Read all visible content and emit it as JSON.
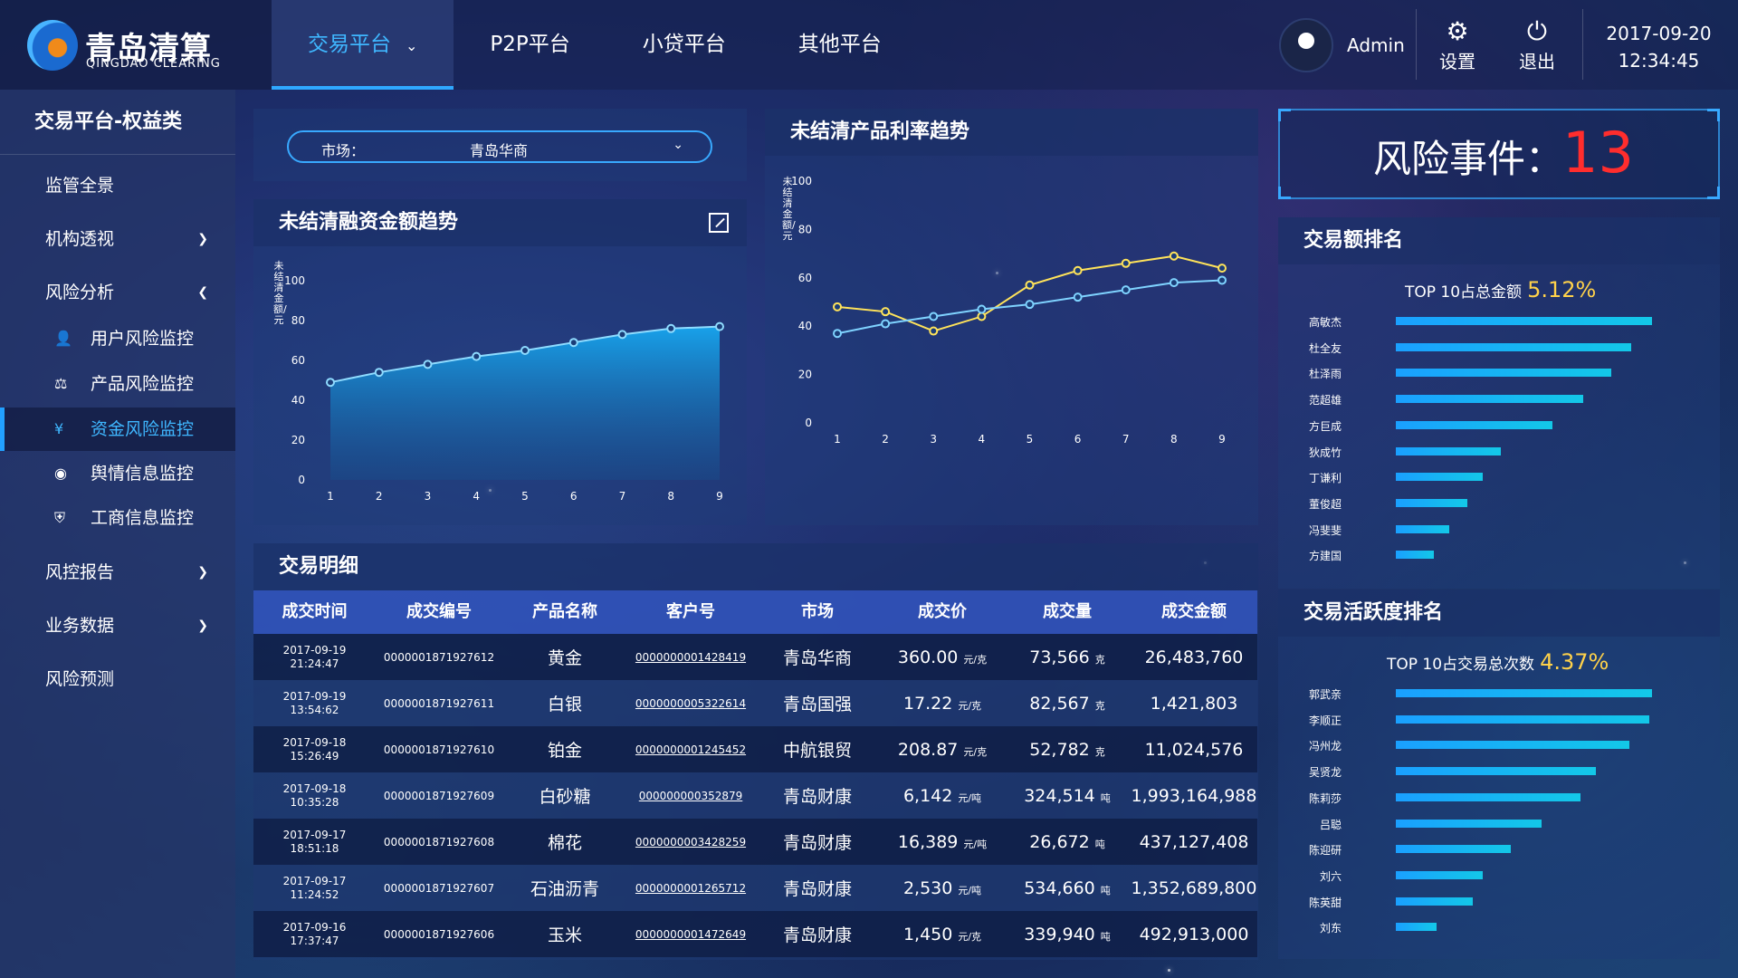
{
  "header": {
    "logo_cn": "青岛清算",
    "logo_en": "QINGDAO CLEARING",
    "nav": [
      {
        "label": "交易平台"
      },
      {
        "label": "P2P平台"
      },
      {
        "label": "小贷平台"
      },
      {
        "label": "其他平台"
      }
    ],
    "user_name": "Admin",
    "settings_label": "设置",
    "logout_label": "退出",
    "date": "2017-09-20",
    "time": "12:34:45"
  },
  "sidebar": {
    "title": "交易平台-权益类",
    "items": [
      {
        "label": "监管全景"
      },
      {
        "label": "机构透视"
      },
      {
        "label": "风险分析"
      },
      {
        "label": "用户风险监控"
      },
      {
        "label": "产品风险监控"
      },
      {
        "label": "资金风险监控"
      },
      {
        "label": "舆情信息监控"
      },
      {
        "label": "工商信息监控"
      },
      {
        "label": "风控报告"
      },
      {
        "label": "业务数据"
      },
      {
        "label": "风险预测"
      }
    ]
  },
  "market": {
    "label": "市场：",
    "value": "青岛华商"
  },
  "chart_data": [
    {
      "type": "area",
      "title": "未结清融资金额趋势",
      "ylabel": "未结清金额/元",
      "x": [
        1,
        2,
        3,
        4,
        5,
        6,
        7,
        8,
        9
      ],
      "values": [
        49,
        54,
        58,
        62,
        65,
        69,
        73,
        76,
        77
      ],
      "ylim": [
        0,
        100
      ],
      "yticks": [
        0,
        20,
        40,
        60,
        80,
        100
      ]
    },
    {
      "type": "line",
      "title": "未结清产品利率趋势",
      "ylabel": "未结清金额/元",
      "x": [
        1,
        2,
        3,
        4,
        5,
        6,
        7,
        8,
        9
      ],
      "series": [
        {
          "color": "#ffe35a",
          "values": [
            48,
            46,
            38,
            44,
            57,
            63,
            66,
            69,
            64
          ]
        },
        {
          "color": "#7fd3ff",
          "values": [
            37,
            41,
            44,
            47,
            49,
            52,
            55,
            58,
            59
          ]
        }
      ],
      "ylim": [
        0,
        100
      ],
      "yticks": [
        0,
        20,
        40,
        60,
        80,
        100
      ]
    }
  ],
  "risk": {
    "label": "风险事件：",
    "count": "13"
  },
  "trade_rank": {
    "title": "交易额排名",
    "top_text": "TOP 10占总金额",
    "top_pct": "5.12%",
    "names": [
      "高敏杰",
      "杜全友",
      "杜泽雨",
      "范超雄",
      "方巨成",
      "狄成竹",
      "丁谦利",
      "董俊超",
      "冯斐斐",
      "方建国"
    ],
    "values": [
      100,
      92,
      84,
      73,
      61,
      41,
      34,
      28,
      21,
      15
    ]
  },
  "active_rank": {
    "title": "交易活跃度排名",
    "top_text": "TOP 10占交易总次数",
    "top_pct": "4.37%",
    "names": [
      "郭武亲",
      "李顺正",
      "冯州龙",
      "吴贤龙",
      "陈莉莎",
      "吕聪",
      "陈迎研",
      "刘六",
      "陈英甜",
      "刘东"
    ],
    "values": [
      100,
      99,
      91,
      78,
      72,
      57,
      45,
      34,
      30,
      16
    ]
  },
  "table": {
    "title": "交易明细",
    "columns": [
      "成交时间",
      "成交编号",
      "产品名称",
      "客户号",
      "市场",
      "成交价",
      "成交量",
      "成交金额"
    ],
    "rows": [
      {
        "date": "2017-09-19",
        "time": "21:24:47",
        "id": "0000001871927612",
        "product": "黄金",
        "cust": "0000000001428419",
        "market": "青岛华商",
        "price": "360.00",
        "price_unit": "元/克",
        "qty": "73,566",
        "qty_unit": "克",
        "amount": "26,483,760"
      },
      {
        "date": "2017-09-19",
        "time": "13:54:62",
        "id": "0000001871927611",
        "product": "白银",
        "cust": "0000000005322614",
        "market": "青岛国强",
        "price": "17.22",
        "price_unit": "元/克",
        "qty": "82,567",
        "qty_unit": "克",
        "amount": "1,421,803"
      },
      {
        "date": "2017-09-18",
        "time": "15:26:49",
        "id": "0000001871927610",
        "product": "铂金",
        "cust": "0000000001245452",
        "market": "中航银贸",
        "price": "208.87",
        "price_unit": "元/克",
        "qty": "52,782",
        "qty_unit": "克",
        "amount": "11,024,576"
      },
      {
        "date": "2017-09-18",
        "time": "10:35:28",
        "id": "0000001871927609",
        "product": "白砂糖",
        "cust": "000000000352879",
        "market": "青岛财康",
        "price": "6,142",
        "price_unit": "元/吨",
        "qty": "324,514",
        "qty_unit": "吨",
        "amount": "1,993,164,988"
      },
      {
        "date": "2017-09-17",
        "time": "18:51:18",
        "id": "0000001871927608",
        "product": "棉花",
        "cust": "0000000003428259",
        "market": "青岛财康",
        "price": "16,389",
        "price_unit": "元/吨",
        "qty": "26,672",
        "qty_unit": "吨",
        "amount": "437,127,408"
      },
      {
        "date": "2017-09-17",
        "time": "11:24:52",
        "id": "0000001871927607",
        "product": "石油沥青",
        "cust": "0000000001265712",
        "market": "青岛财康",
        "price": "2,530",
        "price_unit": "元/吨",
        "qty": "534,660",
        "qty_unit": "吨",
        "amount": "1,352,689,800"
      },
      {
        "date": "2017-09-16",
        "time": "17:37:47",
        "id": "0000001871927606",
        "product": "玉米",
        "cust": "0000000001472649",
        "market": "青岛财康",
        "price": "1,450",
        "price_unit": "元/克",
        "qty": "339,940",
        "qty_unit": "吨",
        "amount": "492,913,000"
      }
    ]
  }
}
